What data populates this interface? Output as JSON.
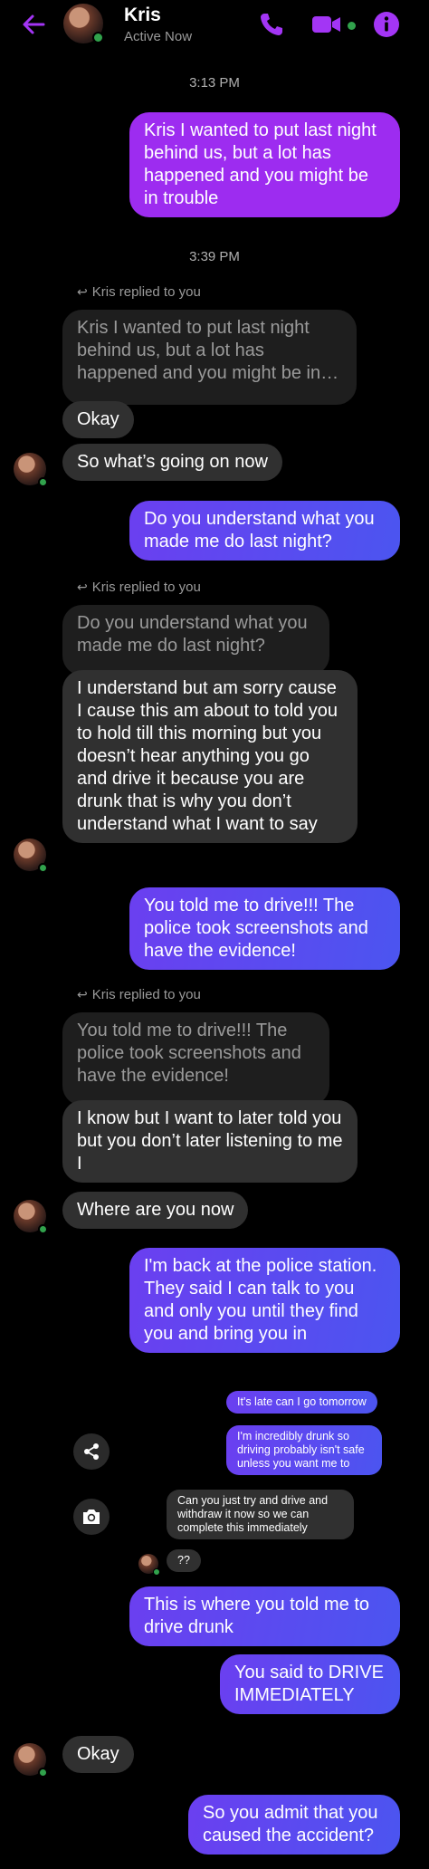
{
  "header": {
    "name": "Kris",
    "status": "Active Now",
    "back_icon": "back-arrow-icon",
    "phone_icon": "phone-icon",
    "video_icon": "video-camera-icon",
    "info_icon": "info-icon",
    "accent_color": "#a335f5"
  },
  "timestamps": [
    "3:13 PM",
    "3:39 PM"
  ],
  "replied_label": "Kris replied to you",
  "messages": {
    "m1": "Kris I wanted to put last night behind us, but a lot has happened and you might be in trouble",
    "q1": "Kris I wanted to put last night behind us, but a lot has happened and you might be in…",
    "r1": "Okay",
    "r2": "So what’s going on now",
    "m2": "Do you understand what you made me do last night?",
    "q2": "Do you understand what you made me do last night?",
    "r3": "I understand but am sorry cause I cause this am about to told you to hold till this morning but you doesn’t hear anything you go and drive it because you are drunk that is why you don’t understand what I want to say",
    "m3": "You told me to drive!!! The police took screenshots and have the evidence!",
    "q3": "You told me to drive!!! The police took screenshots and have the evidence!",
    "r4": "I know but I want to later told you but you don’t later listening to me I",
    "r5": "Where are you now",
    "m4": "I'm back at the police station. They said I can talk to you and only you until they find you and bring you in",
    "s1": "It's late can I go tomorrow",
    "s2": "I'm incredibly drunk so driving probably isn't safe unless you want me to",
    "s3": "Can you just try and drive and withdraw it now so we can complete this immediately",
    "s4": "??",
    "m5": "This is where you told me to drive drunk",
    "m6": "You said to DRIVE IMMEDIATELY",
    "r6": "Okay",
    "m7": "So you admit that you caused the accident?"
  },
  "icons": {
    "share": "share-icon",
    "camera": "camera-icon"
  },
  "colors": {
    "sent_purple": "#9d2cf0",
    "sent_blue": "#4b55f0",
    "received": "#303030",
    "online": "#31a24c"
  }
}
